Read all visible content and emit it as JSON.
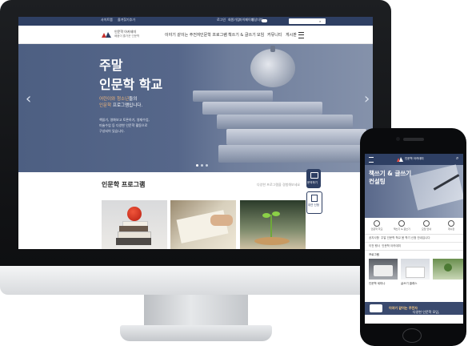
{
  "desktop": {
    "utility_bar": {
      "left_links": [
        "사이트맵",
        "즐겨찾기추가"
      ],
      "right_links": [
        "로그인",
        "회원가입",
        "마이페이지",
        "영상더빙"
      ],
      "search_placeholder": ""
    },
    "logo": {
      "line1": "인문학 아카데미",
      "line2": "배움이 즐거운 인문학"
    },
    "nav": {
      "items": [
        "이야기 같이는 주전자",
        "인문학 프로그램",
        "책쓰기 & 글쓰기",
        "모임",
        "커뮤니티",
        "게시판"
      ]
    },
    "hero": {
      "title_line1": "주말",
      "title_line2": "인문학 학교",
      "subtitle_highlight": "어린이와 청소년",
      "subtitle_suffix": "들의",
      "subtitle_line2_highlight": "인문학",
      "subtitle_line2_suffix": " 프로그램입니다.",
      "desc_lines": [
        "책읽기, 영화보고 토론하기, 영재수업,",
        "미술수업 등 다양한 인문학 활동으로",
        "구성되어 있습니다."
      ],
      "prev_label": "‹",
      "next_label": "›",
      "slide_count": 3,
      "active_slide": 1
    },
    "programs": {
      "title": "인문학 프로그램",
      "more_text": "다양한 프로그램을 경험해보세요",
      "side_buttons": [
        "문의하기",
        "대관 신청"
      ]
    }
  },
  "mobile": {
    "logo": "인문학 아카데미",
    "hero": {
      "line1": "책쓰기 & 글쓰기",
      "line2": "컨설팅"
    },
    "quick_icons": [
      "인문학 학교",
      "책쓰기 & 글쓰기",
      "모임 안내",
      "게시판"
    ],
    "info_rows": [
      {
        "label": "공지사항",
        "text": "주말 인문학 학교 봄 학기 신청 안내입니다"
      },
      {
        "label": "이전 행사",
        "text": "인문학 아카데미"
      }
    ],
    "section_label": "프로그램",
    "cards": [
      {
        "caption": "인문학 세미나",
        "sub": ""
      },
      {
        "caption": "글쓰기 클래스",
        "sub": ""
      }
    ],
    "banner": {
      "prefix": "다양한 인문학 모임,",
      "highlight": "이야기 같이는 주전자"
    }
  },
  "colors": {
    "navy": "#2e3f63",
    "hero_accent": "#f3b77a"
  }
}
